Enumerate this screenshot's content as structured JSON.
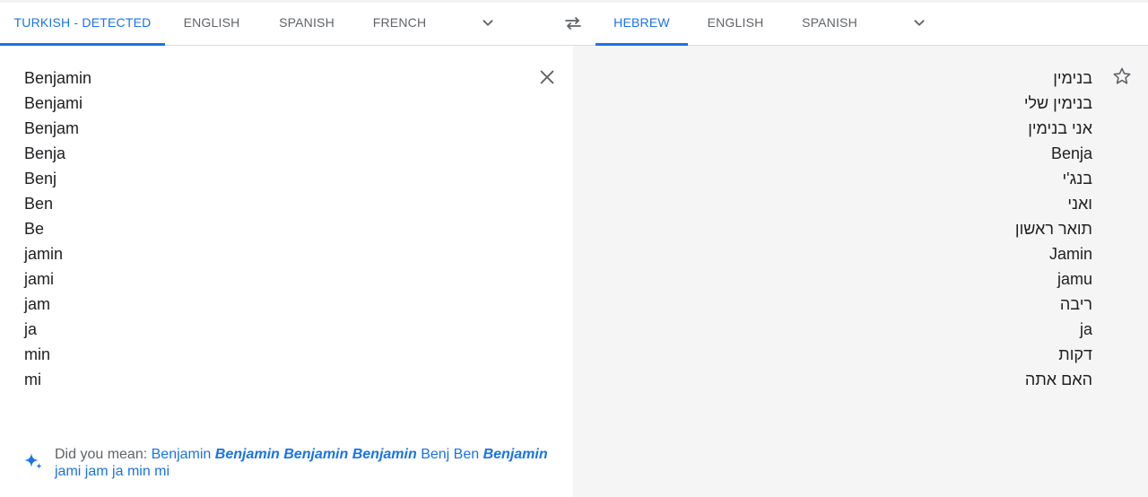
{
  "source_langs": {
    "tabs": [
      {
        "label": "TURKISH - DETECTED",
        "active": true
      },
      {
        "label": "ENGLISH",
        "active": false
      },
      {
        "label": "SPANISH",
        "active": false
      },
      {
        "label": "FRENCH",
        "active": false
      }
    ],
    "more_icon": "chevron-down-icon"
  },
  "swap_icon": "swap-horiz-icon",
  "target_langs": {
    "tabs": [
      {
        "label": "HEBREW",
        "active": true
      },
      {
        "label": "ENGLISH",
        "active": false
      },
      {
        "label": "SPANISH",
        "active": false
      }
    ],
    "more_icon": "chevron-down-icon"
  },
  "source": {
    "lines": [
      "Benjamin",
      "Benjami",
      "Benjam",
      "Benja",
      "Benj",
      "Ben",
      "Be",
      "jamin",
      "jami",
      "jam",
      "ja",
      "min",
      "mi"
    ],
    "clear_icon": "close-icon"
  },
  "target": {
    "lines": [
      "בנימין",
      "בנימין שלי",
      "אני בנימין",
      "Benja",
      "בנג'י",
      "ואני",
      "תואר ראשון",
      "Jamin",
      "jamu",
      "ריבה",
      "ja",
      "דקות",
      "האם אתה"
    ],
    "save_icon": "star-outline-icon"
  },
  "did_you_mean": {
    "prefix": "Did you mean:",
    "icon": "sparkle-icon",
    "suggestions": [
      {
        "text": "Benjamin",
        "emphasis": false
      },
      {
        "text": "Benjamin",
        "emphasis": true
      },
      {
        "text": "Benjamin",
        "emphasis": true
      },
      {
        "text": "Benjamin",
        "emphasis": true
      },
      {
        "text": "Benj",
        "emphasis": false
      },
      {
        "text": "Ben",
        "emphasis": false
      },
      {
        "text": "Benjamin",
        "emphasis": true
      },
      {
        "text": "jami",
        "emphasis": false
      },
      {
        "text": "jam",
        "emphasis": false
      },
      {
        "text": "ja",
        "emphasis": false
      },
      {
        "text": "min",
        "emphasis": false
      },
      {
        "text": "mi",
        "emphasis": false
      }
    ]
  },
  "colors": {
    "accent": "#1a73e8",
    "text": "#202124",
    "muted": "#5f6368",
    "target_bg": "#f5f5f5"
  }
}
